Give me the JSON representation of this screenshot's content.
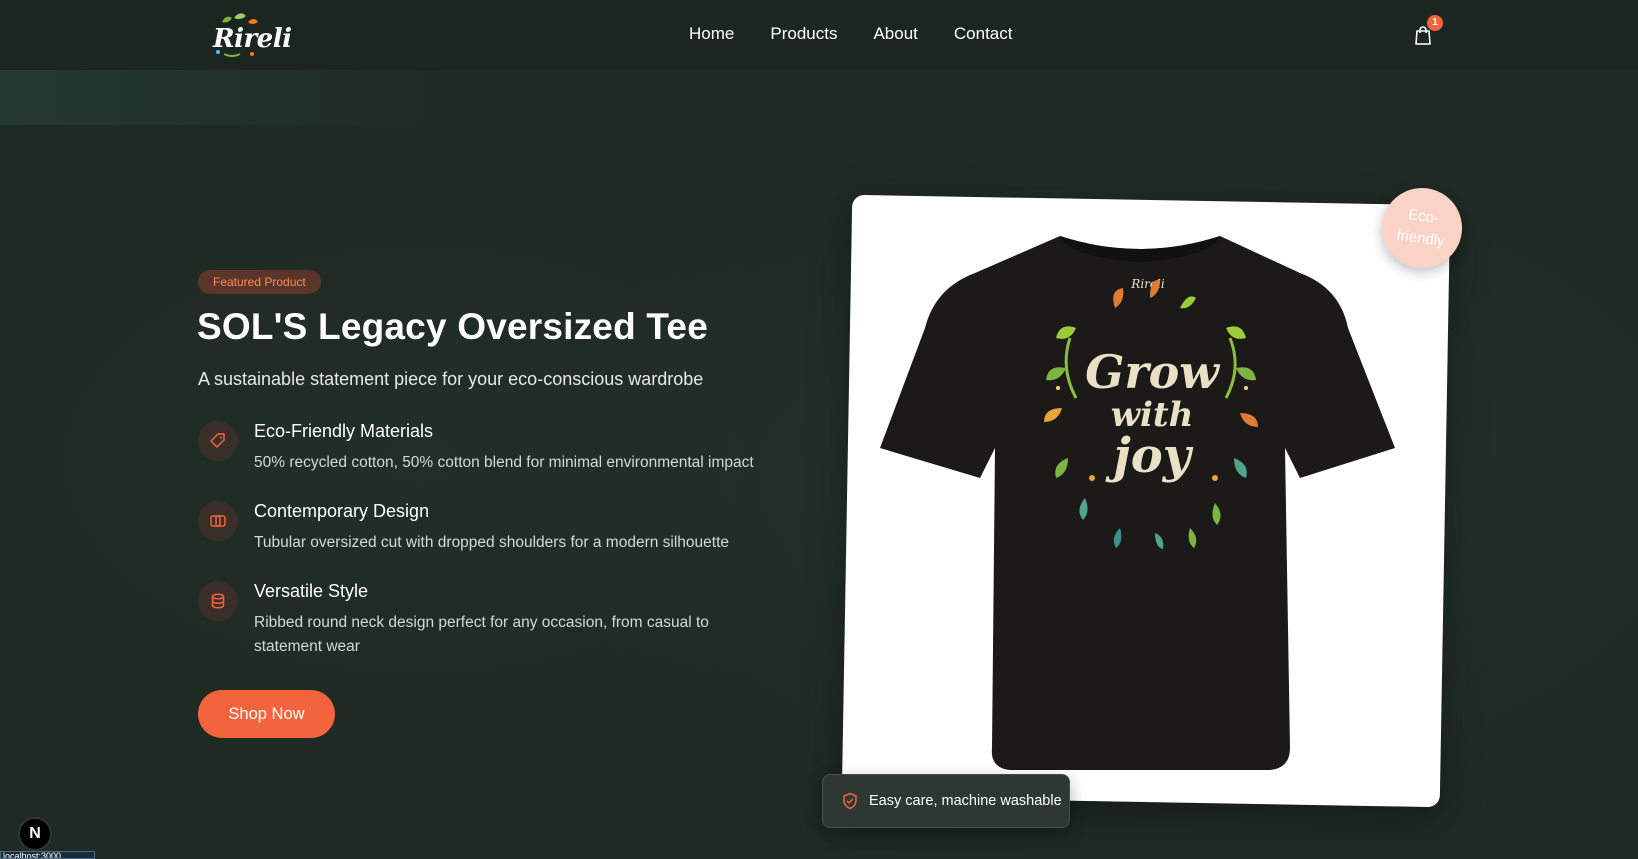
{
  "brand": {
    "logo_text": "Rireli",
    "accent": "#f2643c"
  },
  "nav": {
    "items": [
      {
        "label": "Home"
      },
      {
        "label": "Products"
      },
      {
        "label": "About"
      },
      {
        "label": "Contact"
      }
    ],
    "cart_count": "1"
  },
  "hero": {
    "badge": "Featured Product",
    "title": "SOL'S Legacy Oversized Tee",
    "subtitle": "A sustainable statement piece for your eco-conscious wardrobe",
    "features": [
      {
        "icon": "tag-icon",
        "name": "Eco-Friendly Materials",
        "desc": "50% recycled cotton, 50% cotton blend for minimal environmental impact"
      },
      {
        "icon": "layers-icon",
        "name": "Contemporary Design",
        "desc": "Tubular oversized cut with dropped shoulders for a modern silhouette"
      },
      {
        "icon": "cylinder-icon",
        "name": "Versatile Style",
        "desc": "Ribbed round neck design perfect for any occasion, from casual to statement wear"
      }
    ],
    "cta_label": "Shop Now"
  },
  "product_image": {
    "eco_badge": "Eco-friendly",
    "care_note": "Easy care, machine washable",
    "print_text": [
      "Grow",
      "with",
      "joy"
    ],
    "tee_logo": "Rireli"
  },
  "dev": {
    "next_badge": "N",
    "tooltip": "localhost:3000"
  }
}
